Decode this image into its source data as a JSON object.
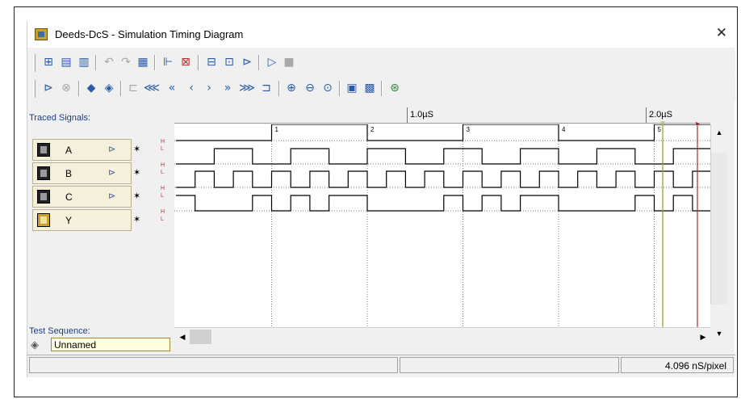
{
  "window": {
    "title": "Deeds-DcS  -  Simulation Timing Diagram",
    "close_glyph": "✕"
  },
  "toolbar1": {
    "buttons": [
      "circuit-icon",
      "document-icon",
      "document-save-icon",
      "undo-icon",
      "redo-icon",
      "clipboard-icon",
      "signal-add-icon",
      "signal-remove-icon",
      "grid-icon",
      "chart-icon",
      "probe-icon",
      "play-icon",
      "stop-icon"
    ]
  },
  "toolbar2": {
    "buttons": [
      "probe-select-icon",
      "probe-clear-icon",
      "step-back-icon",
      "step-forward-icon",
      "ruler-icon",
      "fast-rewind-icon",
      "rewind-icon",
      "step-left-icon",
      "step-right-icon",
      "forward-icon",
      "fast-forward-icon",
      "ruler-end-icon",
      "zoom-in-icon",
      "zoom-out-icon",
      "zoom-fit-icon",
      "table-in-icon",
      "table-out-icon",
      "settings-icon"
    ]
  },
  "signals_panel": {
    "header": "Traced Signals:",
    "signals": [
      {
        "name": "A"
      },
      {
        "name": "B"
      },
      {
        "name": "C"
      },
      {
        "name": "Y"
      }
    ],
    "level_labels": {
      "high": "H",
      "low": "L"
    }
  },
  "test_sequence": {
    "label": "Test Sequence:",
    "value": "Unnamed"
  },
  "ruler": {
    "labels": [
      "1.0µS",
      "2.0µS"
    ]
  },
  "timing_data": {
    "time_unit": "µs",
    "cursor_labels": [
      "1",
      "2",
      "3",
      "4",
      "5"
    ],
    "A": [
      0,
      0,
      0,
      0,
      0,
      1,
      1,
      1,
      1,
      1,
      0,
      0,
      0,
      0,
      0,
      1,
      1,
      1,
      1,
      1,
      0,
      0,
      0,
      0,
      0,
      1,
      1,
      1
    ],
    "B": [
      0,
      0,
      1,
      1,
      0,
      0,
      1,
      1,
      0,
      0,
      1,
      1,
      0,
      0,
      1,
      1,
      0,
      0,
      1,
      1,
      0,
      0,
      1,
      1,
      0,
      0,
      1,
      1
    ],
    "C": [
      0,
      1,
      0,
      1,
      0,
      1,
      0,
      1,
      0,
      1,
      0,
      1,
      0,
      1,
      0,
      1,
      0,
      1,
      0,
      1,
      0,
      1,
      0,
      1,
      0,
      1,
      0,
      1
    ],
    "Y": [
      1,
      0,
      0,
      0,
      1,
      0,
      1,
      0,
      1,
      1,
      0,
      0,
      0,
      0,
      1,
      0,
      1,
      0,
      1,
      1,
      0,
      0,
      0,
      0,
      1,
      0,
      1,
      0
    ]
  },
  "status": {
    "resolution": "4.096 nS/pixel"
  },
  "colors": {
    "accent": "#2a5aa8",
    "signal_line": "#000000",
    "grid_dots": "#7a7a7a",
    "cursor_green": "#8aa020",
    "cursor_red": "#a03030"
  }
}
